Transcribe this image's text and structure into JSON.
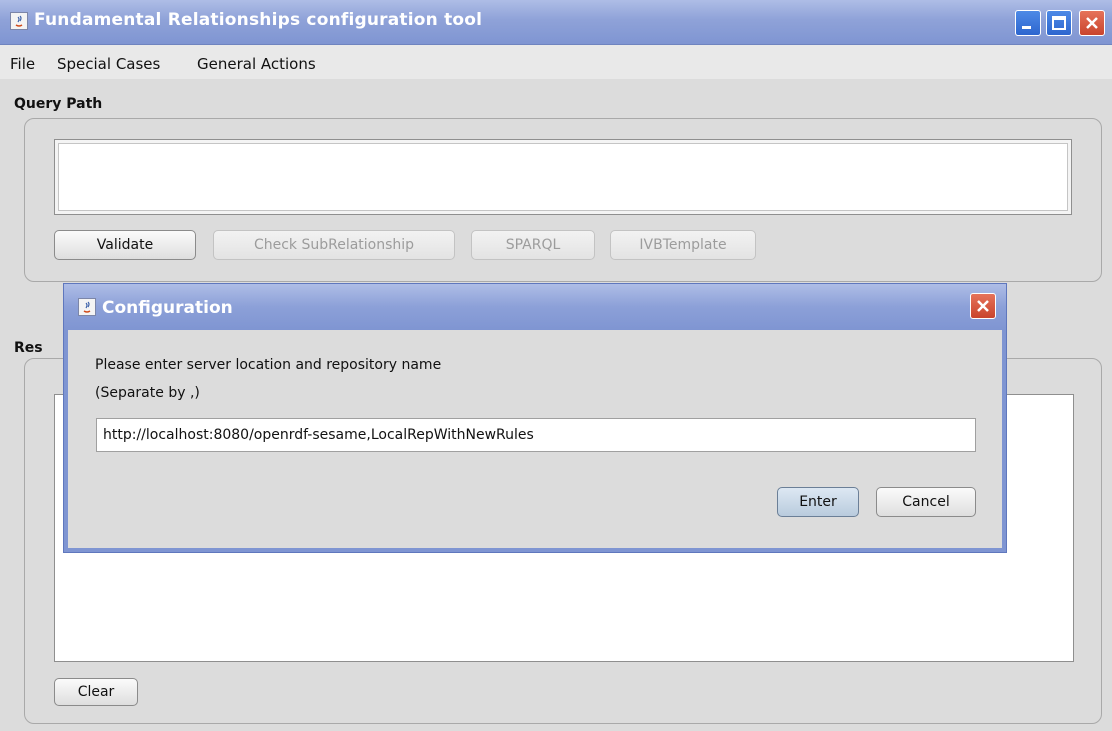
{
  "window": {
    "title": "Fundamental Relationships configuration tool",
    "titlebar_color": "#8fa2d8",
    "controls": [
      "minimize-icon",
      "maximize-icon",
      "close-icon"
    ]
  },
  "menu": {
    "items": [
      {
        "label": "File"
      },
      {
        "label": "Special Cases"
      },
      {
        "label": "General Actions"
      }
    ]
  },
  "query_section": {
    "label": "Query Path",
    "value": "",
    "buttons": [
      {
        "label": "Validate",
        "enabled": true
      },
      {
        "label": "Check SubRelationship",
        "enabled": false
      },
      {
        "label": "SPARQL",
        "enabled": false
      },
      {
        "label": "IVBTemplate",
        "enabled": false
      }
    ]
  },
  "results_section": {
    "label": "Res",
    "value": "",
    "clear_label": "Clear"
  },
  "dialog": {
    "title": "Configuration",
    "message_line1": "Please enter server location and repository name",
    "message_line2": "(Separate by ,)",
    "input_value": "http://localhost:8080/openrdf-sesame,LocalRepWithNewRules",
    "enter_label": "Enter",
    "cancel_label": "Cancel"
  }
}
